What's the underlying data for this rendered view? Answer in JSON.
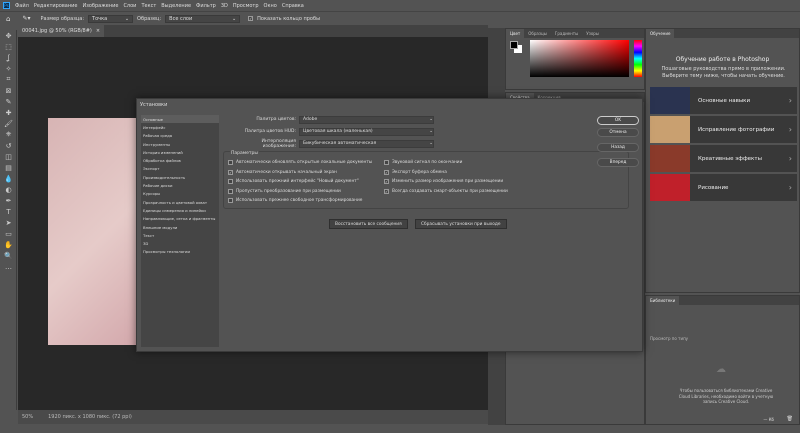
{
  "menu": [
    "Файл",
    "Редактирование",
    "Изображение",
    "Слои",
    "Текст",
    "Выделение",
    "Фильтр",
    "3D",
    "Просмотр",
    "Окно",
    "Справка"
  ],
  "options": {
    "sample_size_label": "Размер образца:",
    "sample_size_value": "Точка",
    "sample_label": "Образец:",
    "sample_value": "Все слои",
    "show_ring_label": "Показать кольцо пробы"
  },
  "document_tab": "00041.jpg @ 50% (RGB/8#)",
  "status": {
    "zoom": "50%",
    "info": "1920 пикс. x 1080 пикс. (72 ppi)"
  },
  "color_panel": {
    "tabs": [
      "Цвет",
      "Образцы",
      "Градиенты",
      "Узоры"
    ],
    "properties_tabs": [
      "Свойства",
      "Коррекция"
    ]
  },
  "learn": {
    "tab": "Обучение",
    "title": "Обучение работе в Photoshop",
    "subtitle": "Пошаговые руководства прямо в приложении. Выберите тему ниже, чтобы начать обучение.",
    "cards": [
      "Основные навыки",
      "Исправление фотографии",
      "Креативные эффекты",
      "Рисование"
    ]
  },
  "libraries": {
    "tab": "Библиотеки",
    "filter": "Просмотр по типу",
    "message": "Чтобы пользоваться библиотеками Creative Cloud Libraries, необходимо войти в учетную запись Creative Cloud.",
    "size": "— Кб"
  },
  "dialog": {
    "title": "Установки",
    "categories": [
      "Основные",
      "Интерфейс",
      "Рабочая среда",
      "Инструменты",
      "История изменений",
      "Обработка файлов",
      "Экспорт",
      "Производительность",
      "Рабочие диски",
      "Курсоры",
      "Прозрачность и цветовой охват",
      "Единицы измерения и линейки",
      "Направляющие, сетка и фрагменты",
      "Внешние модули",
      "Текст",
      "3D",
      "Просмотры технологии"
    ],
    "fields": [
      {
        "label": "Палитра цветов:",
        "value": "Adobe"
      },
      {
        "label": "Палитра цветов HUD:",
        "value": "Цветовая шкала (маленькая)"
      },
      {
        "label": "Интерполяция изображения:",
        "value": "Бикубическая автоматическая"
      }
    ],
    "params_title": "Параметры",
    "options_left": [
      {
        "label": "Автоматически обновлять открытые локальные документы",
        "checked": false
      },
      {
        "label": "Автоматически открывать начальный экран",
        "checked": true
      },
      {
        "label": "Использовать прежний интерфейс \"Новый документ\"",
        "checked": false
      },
      {
        "label": "Пропустить преобразование при размещении",
        "checked": false
      },
      {
        "label": "Использовать прежнее свободное трансформирование",
        "checked": false
      }
    ],
    "options_right": [
      {
        "label": "Звуковой сигнал по окончании",
        "checked": false
      },
      {
        "label": "Экспорт буфера обмена",
        "checked": true
      },
      {
        "label": "Изменить размер изображения при размещении",
        "checked": true
      },
      {
        "label": "Всегда создавать смарт-объекты при размещении",
        "checked": true
      }
    ],
    "reset_messages": "Восстановить все сообщения",
    "reset_on_quit": "Сбрасывать установки при выходе",
    "buttons": {
      "ok": "OK",
      "cancel": "Отмена",
      "prev": "Назад",
      "next": "Вперед"
    }
  }
}
